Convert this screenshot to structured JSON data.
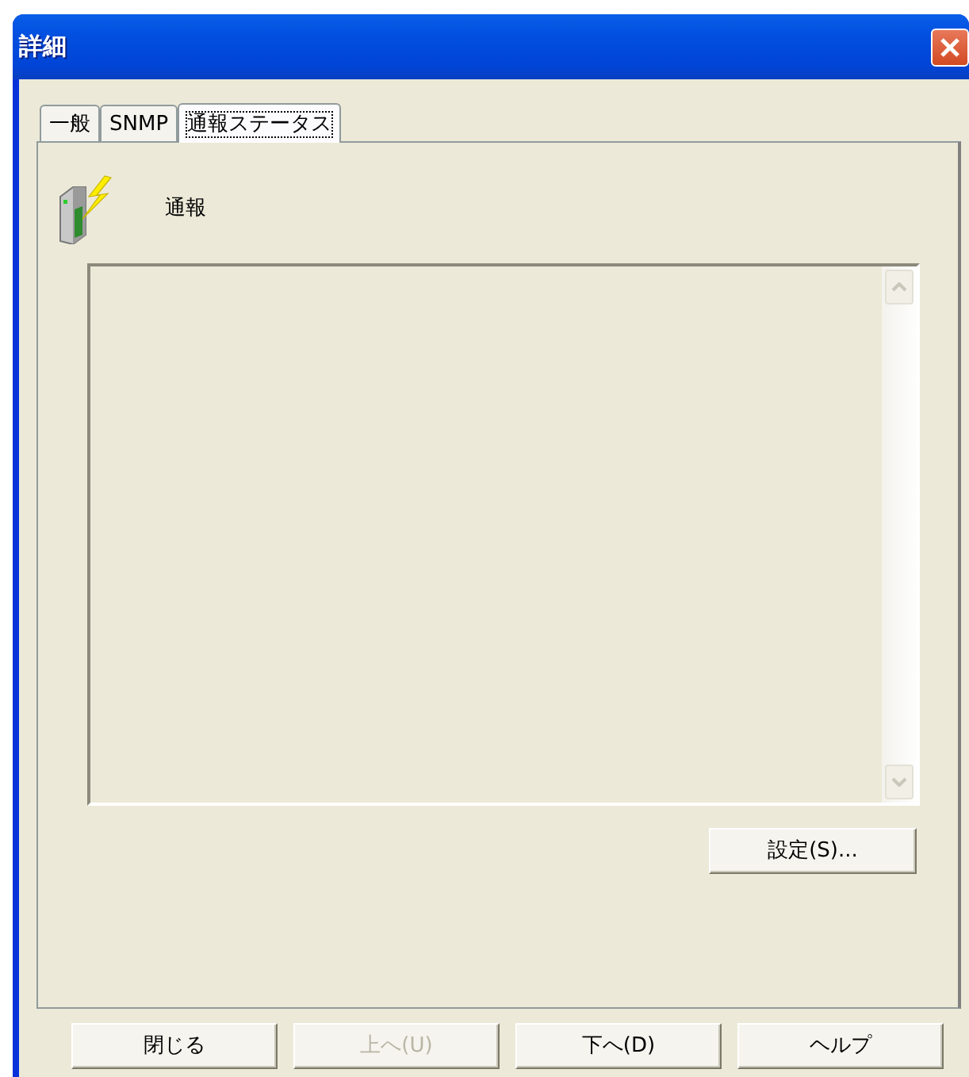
{
  "window": {
    "title": "詳細"
  },
  "tabs": [
    {
      "label": "一般",
      "selected": false
    },
    {
      "label": "SNMP",
      "selected": false
    },
    {
      "label": "通報ステータス",
      "selected": true
    }
  ],
  "panel": {
    "label": "通報",
    "list": {
      "disabled": true
    },
    "settings_button": {
      "label": "設定(S)...",
      "disabled": false
    }
  },
  "buttons": [
    {
      "label": "閉じる",
      "disabled": false
    },
    {
      "label": "上へ(U)",
      "disabled": true
    },
    {
      "label": "下へ(D)",
      "disabled": false
    },
    {
      "label": "ヘルプ",
      "disabled": false
    }
  ]
}
